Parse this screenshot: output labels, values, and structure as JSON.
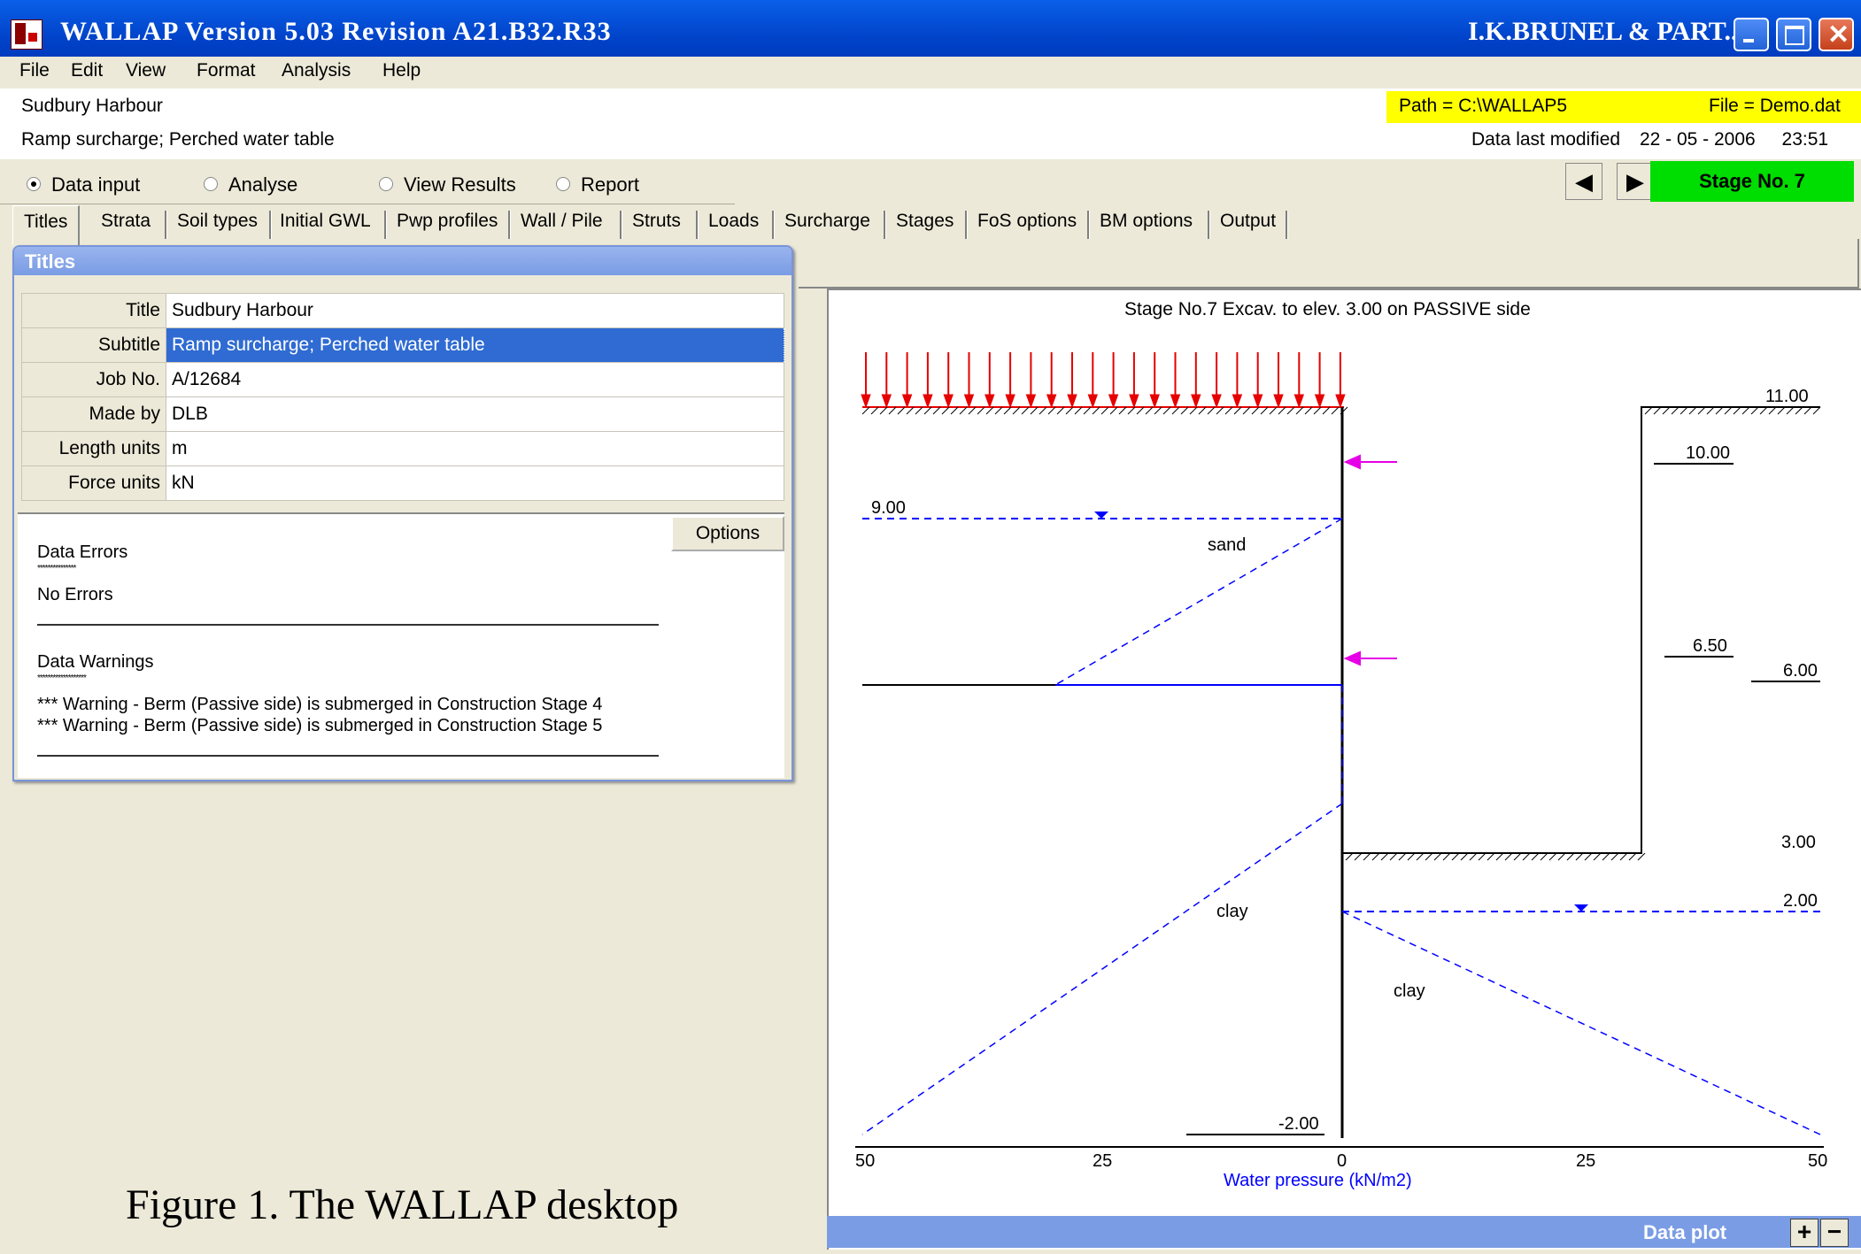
{
  "window": {
    "title": "WALLAP   Version 5.03  Revision A21.B32.R33",
    "right_title": "I.K.BRUNEL & PART...",
    "icons": [
      "app-icon",
      "minimize-icon",
      "maximize-icon",
      "close-icon"
    ]
  },
  "menu": [
    "File",
    "Edit",
    "View",
    "Format",
    "Analysis",
    "Help"
  ],
  "info": {
    "title": "Sudbury Harbour",
    "subtitle": "Ramp surcharge;  Perched water table",
    "path": "Path = C:\\WALLAP5",
    "file": "File = Demo.dat",
    "modified_label": "Data last modified",
    "modified_date": "22 - 05 - 2006",
    "modified_time": "23:51"
  },
  "modes": {
    "items": [
      "Data input",
      "Analyse",
      "View Results",
      "Report"
    ],
    "selected": "Data input"
  },
  "stage": {
    "label": "Stage No. 7",
    "color": "#00dd00"
  },
  "tabs": [
    "Titles",
    "Strata",
    "Soil types",
    "Initial GWL",
    "Pwp profiles",
    "Wall / Pile",
    "Struts",
    "Loads",
    "Surcharge",
    "Stages",
    "FoS options",
    "BM options",
    "Output"
  ],
  "panel": {
    "heading": "Titles",
    "fields": [
      {
        "label": "Title",
        "value": "Sudbury Harbour"
      },
      {
        "label": "Subtitle",
        "value": "Ramp surcharge;  Perched water table"
      },
      {
        "label": "Job No.",
        "value": "A/12684"
      },
      {
        "label": "Made by",
        "value": "DLB"
      },
      {
        "label": "Length units",
        "value": "m"
      },
      {
        "label": "Force units",
        "value": "kN"
      }
    ],
    "options_button": "Options",
    "errors_heading": "Data Errors",
    "errors_stars": "***************",
    "errors_text": "No Errors",
    "warnings_heading": "Data Warnings",
    "warnings_stars": "*******************",
    "warnings": [
      "*** Warning - Berm (Passive side) is submerged in Construction Stage 4",
      "*** Warning - Berm (Passive side) is submerged in Construction Stage 5"
    ]
  },
  "plot": {
    "heading": "Stage No.7    Excav. to elev. 3.00 on PASSIVE side",
    "elev_labels": {
      "e11": "11.00",
      "e10": "10.00",
      "e9": "9.00",
      "e650": "6.50",
      "e6": "6.00",
      "e3": "3.00",
      "e2": "2.00",
      "em2": "-2.00"
    },
    "soils": {
      "sand": "sand",
      "clay_left": "clay",
      "clay_right": "clay"
    },
    "axis_ticks": [
      "50",
      "25",
      "0",
      "25",
      "50"
    ],
    "axis_label": "Water pressure (kN/m2)",
    "footer": "Data plot",
    "zoom_in": "+",
    "zoom_out": "−",
    "colors": {
      "surcharge": "#e60000",
      "water": "#0000ff",
      "load": "#e600e6"
    }
  },
  "caption": "Figure 1. The WALLAP desktop"
}
